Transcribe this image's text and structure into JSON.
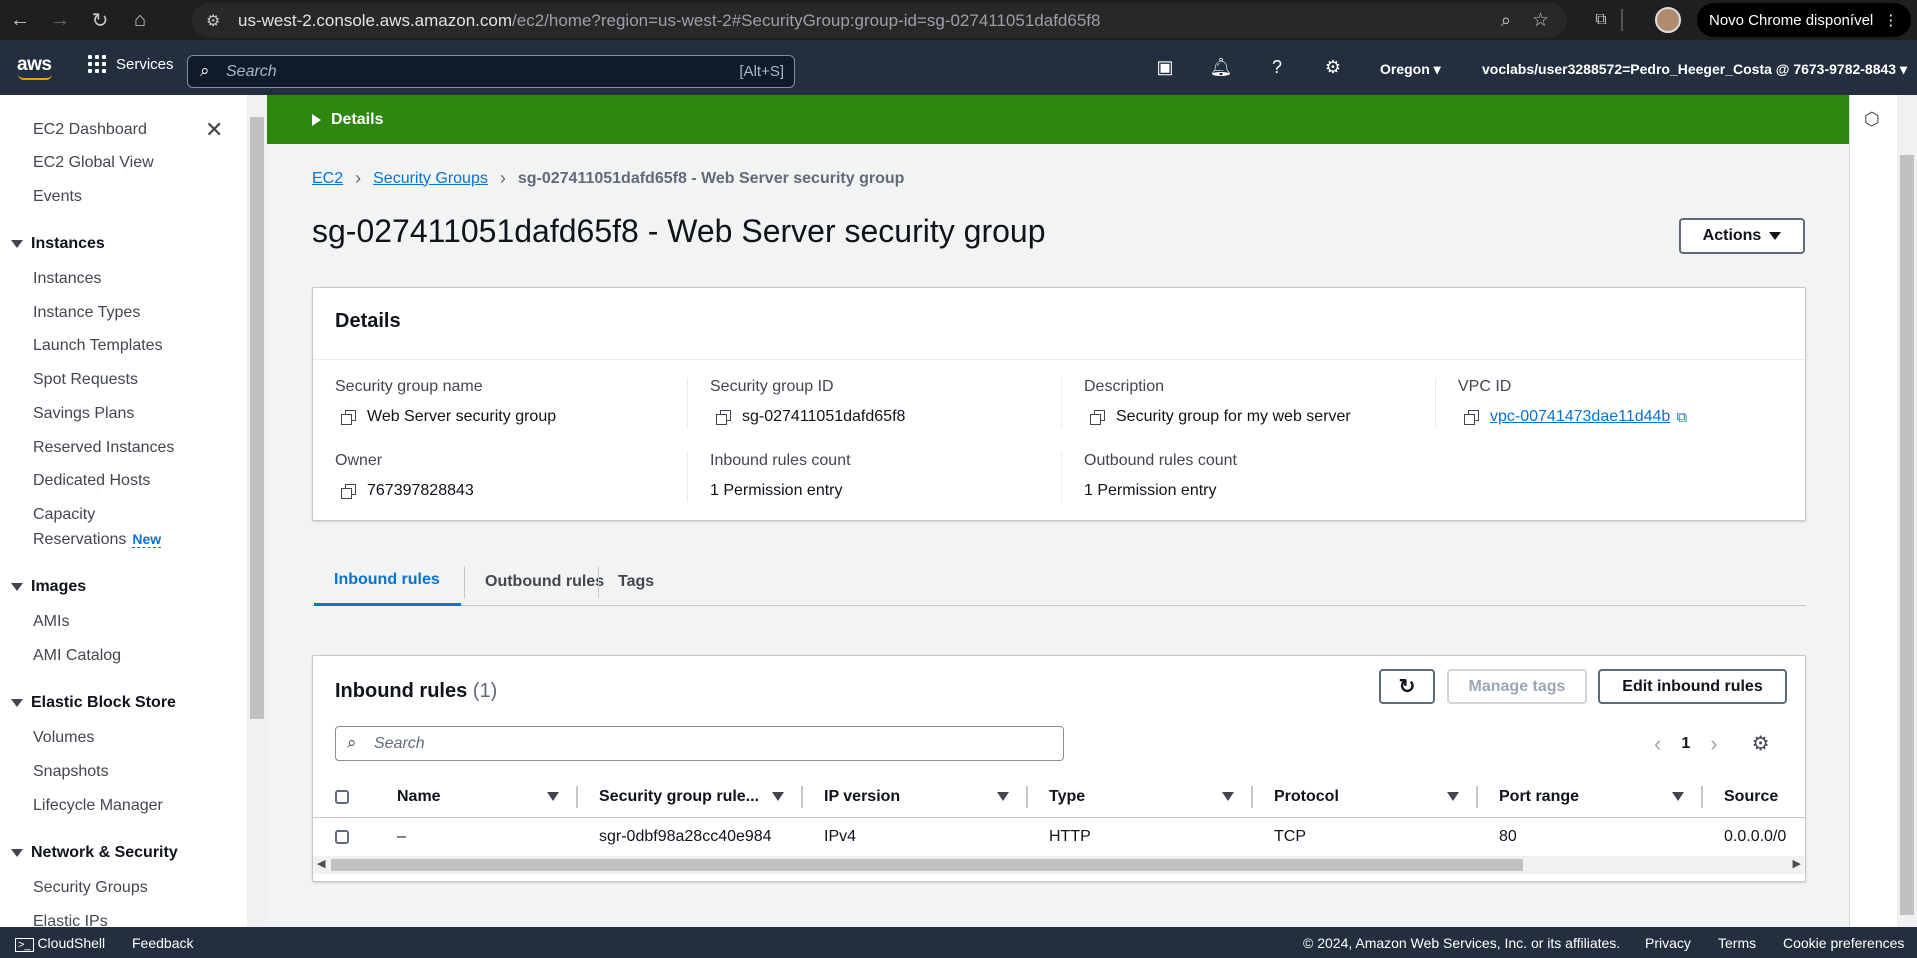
{
  "browser": {
    "url_host": "us-west-2.console.aws.amazon.com",
    "url_path": "/ec2/home?region=us-west-2#SecurityGroup:group-id=sg-027411051dafd65f8",
    "update_label": "Novo Chrome disponível"
  },
  "aws_nav": {
    "logo": "aws",
    "services": "Services",
    "search_placeholder": "Search",
    "search_shortcut": "[Alt+S]",
    "region": "Oregon",
    "account": "voclabs/user3288572=Pedro_Heeger_Costa @ 7673-9782-8843"
  },
  "sidebar": {
    "top": [
      "EC2 Dashboard",
      "EC2 Global View",
      "Events"
    ],
    "instances_head": "Instances",
    "instances": [
      "Instances",
      "Instance Types",
      "Launch Templates",
      "Spot Requests",
      "Savings Plans",
      "Reserved Instances",
      "Dedicated Hosts",
      "Capacity",
      "Reservations"
    ],
    "new_badge": "New",
    "images_head": "Images",
    "images": [
      "AMIs",
      "AMI Catalog"
    ],
    "ebs_head": "Elastic Block Store",
    "ebs": [
      "Volumes",
      "Snapshots",
      "Lifecycle Manager"
    ],
    "net_head": "Network & Security",
    "net": [
      "Security Groups",
      "Elastic IPs"
    ]
  },
  "banner": {
    "label": "Details"
  },
  "breadcrumb": {
    "ec2": "EC2",
    "sg": "Security Groups",
    "current": "sg-027411051dafd65f8 - Web Server security group"
  },
  "page_title": "sg-027411051dafd65f8 - Web Server security group",
  "actions_label": "Actions",
  "details": {
    "title": "Details",
    "sg_name_label": "Security group name",
    "sg_name": "Web Server security group",
    "sg_id_label": "Security group ID",
    "sg_id": "sg-027411051dafd65f8",
    "desc_label": "Description",
    "desc": "Security group for my web server",
    "vpc_label": "VPC ID",
    "vpc": "vpc-00741473dae11d44b",
    "owner_label": "Owner",
    "owner": "767397828843",
    "inbound_count_label": "Inbound rules count",
    "inbound_count": "1 Permission entry",
    "outbound_count_label": "Outbound rules count",
    "outbound_count": "1 Permission entry"
  },
  "tabs": [
    "Inbound rules",
    "Outbound rules",
    "Tags"
  ],
  "rules": {
    "title": "Inbound rules",
    "count": "(1)",
    "manage_tags": "Manage tags",
    "edit": "Edit inbound rules",
    "search_placeholder": "Search",
    "page": "1",
    "columns": [
      "Name",
      "Security group rule...",
      "IP version",
      "Type",
      "Protocol",
      "Port range",
      "Source"
    ],
    "row": [
      "–",
      "sgr-0dbf98a28cc40e984",
      "IPv4",
      "HTTP",
      "TCP",
      "80",
      "0.0.0.0/0"
    ]
  },
  "footer": {
    "cloudshell": "CloudShell",
    "feedback": "Feedback",
    "copyright": "© 2024, Amazon Web Services, Inc. or its affiliates.",
    "privacy": "Privacy",
    "terms": "Terms",
    "cookies": "Cookie preferences"
  }
}
